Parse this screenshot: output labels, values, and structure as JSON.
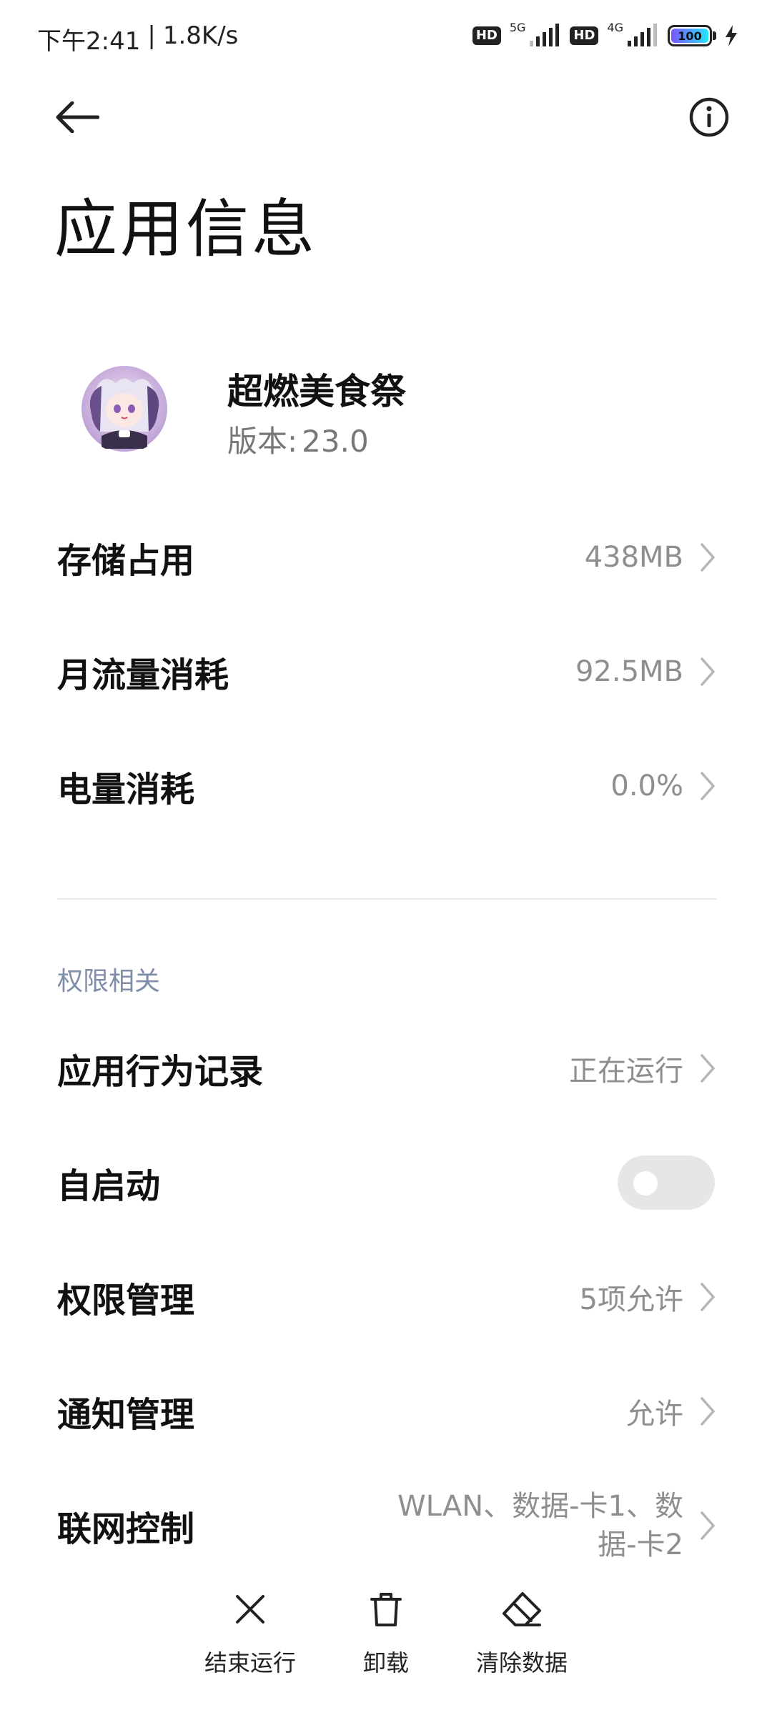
{
  "status_bar": {
    "time": "下午2:41",
    "speed": "1.8K/s",
    "hd1": "HD",
    "net1": "5G",
    "hd2": "HD",
    "net2": "4G",
    "battery": "100"
  },
  "header": {
    "title": "应用信息"
  },
  "app": {
    "name": "超燃美食祭",
    "version_label": "版本:",
    "version": "23.0"
  },
  "usage": {
    "storage_label": "存储占用",
    "storage_value": "438MB",
    "traffic_label": "月流量消耗",
    "traffic_value": "92.5MB",
    "battery_label": "电量消耗",
    "battery_value": "0.0%"
  },
  "permissions": {
    "section_title": "权限相关",
    "behavior_label": "应用行为记录",
    "behavior_value": "正在运行",
    "autostart_label": "自启动",
    "autostart_on": false,
    "manage_label": "权限管理",
    "manage_value": "5项允许",
    "notify_label": "通知管理",
    "notify_value": "允许",
    "network_label": "联网控制",
    "network_value_line1": "WLAN、数据-卡1、数",
    "network_value_line2": "据-卡2"
  },
  "actions": {
    "stop": "结束运行",
    "uninstall": "卸载",
    "clear": "清除数据"
  },
  "colors": {
    "section_header": "#7f8da8",
    "value_text": "#8e8e8e",
    "toggle_off": "#e6e6e6"
  }
}
